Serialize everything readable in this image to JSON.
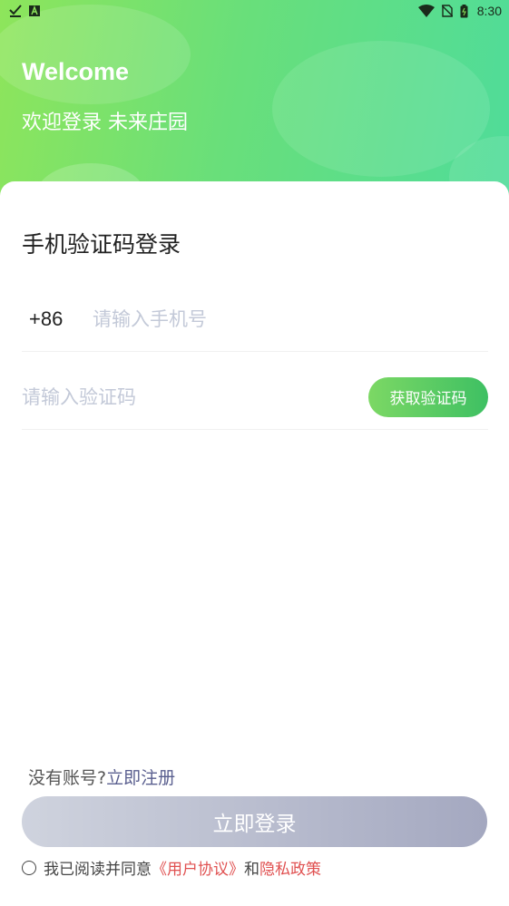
{
  "status_bar": {
    "left_icons": [
      "check-download-icon",
      "a-box-icon"
    ],
    "right_icons": [
      "wifi-icon",
      "no-sim-icon",
      "battery-icon"
    ],
    "time": "8:30"
  },
  "header": {
    "welcome": "Welcome",
    "subtitle": "欢迎登录 未来庄园"
  },
  "form": {
    "title": "手机验证码登录",
    "country_code": "+86",
    "phone_placeholder": "请输入手机号",
    "code_placeholder": "请输入验证码",
    "get_code_label": "获取验证码"
  },
  "footer": {
    "no_account_text": "没有账号?",
    "register_link": "立即注册",
    "login_label": "立即登录",
    "agreement_prefix": "我已阅读并同意",
    "user_agreement": "《用户协议》",
    "and_text": "和",
    "privacy_policy": "隐私政策"
  },
  "colors": {
    "hero_start": "#8ee55b",
    "hero_end": "#4fdc9a",
    "code_button": "#3ec063",
    "login_button": "#a4a8c0",
    "link_red": "#e05050",
    "register_link": "#5a5f8f"
  }
}
